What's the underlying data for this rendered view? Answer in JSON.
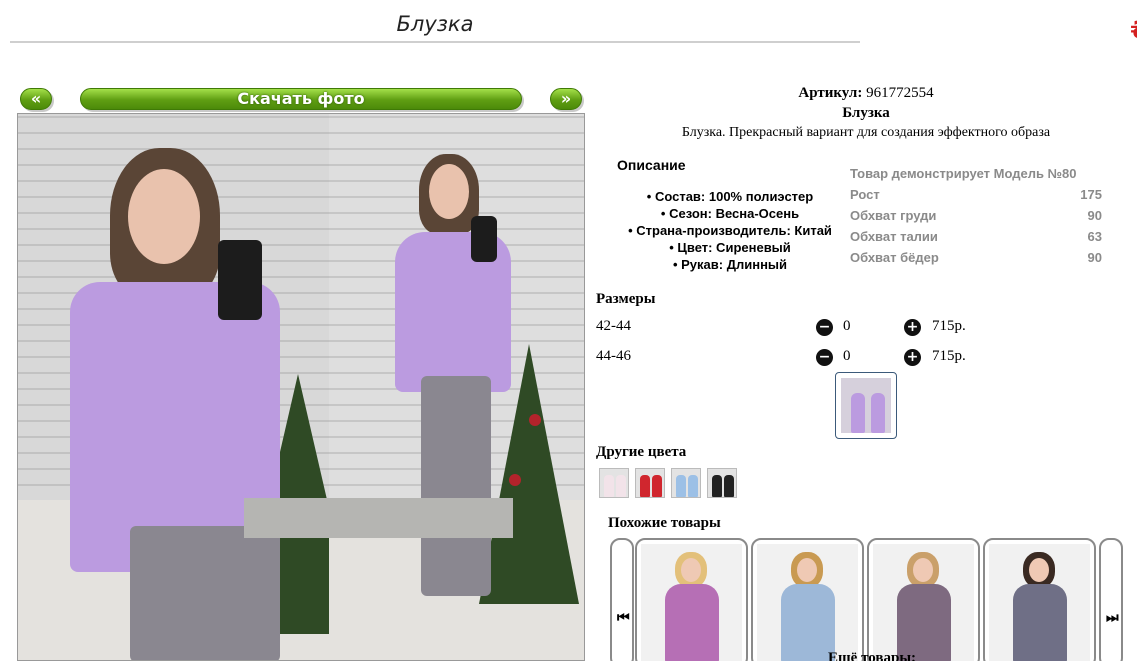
{
  "page": {
    "title": "Блузка",
    "close_mark": "₴"
  },
  "gallery": {
    "prev_label": "«",
    "download_label": "Скачать фото",
    "next_label": "»"
  },
  "product": {
    "article_label": "Артикул:",
    "article_value": "961772554",
    "name": "Блузка",
    "description": "Блузка. Прекрасный вариант для создания эффектного образа"
  },
  "description": {
    "heading": "Описание",
    "items": [
      "Состав: 100% полиэстер",
      "Сезон: Весна-Осень",
      "Страна-производитель: Китай",
      "Цвет: Сиреневый",
      "Рукав: Длинный"
    ]
  },
  "model": {
    "rows": [
      {
        "label": "Товар демонстрирует Модель №80",
        "value": ""
      },
      {
        "label": "Рост",
        "value": "175"
      },
      {
        "label": "Обхват груди",
        "value": "90"
      },
      {
        "label": "Обхват талии",
        "value": "63"
      },
      {
        "label": "Обхват бёдер",
        "value": "90"
      }
    ]
  },
  "sizes": {
    "heading": "Размеры",
    "rows": [
      {
        "size": "42-44",
        "qty": "0",
        "price": "715р."
      },
      {
        "size": "44-46",
        "qty": "0",
        "price": "715р."
      }
    ]
  },
  "other_colors": {
    "heading": "Другие цвета"
  },
  "similar": {
    "heading": "Похожие товары",
    "prev_glyph": "⏮",
    "next_glyph": "⏭"
  },
  "more": {
    "label": "Ещё товары:"
  },
  "colors": {
    "accent_green": "#5f9e13",
    "blouse_lilac": "#bb9be0",
    "muted_text": "#8a8a8a"
  }
}
